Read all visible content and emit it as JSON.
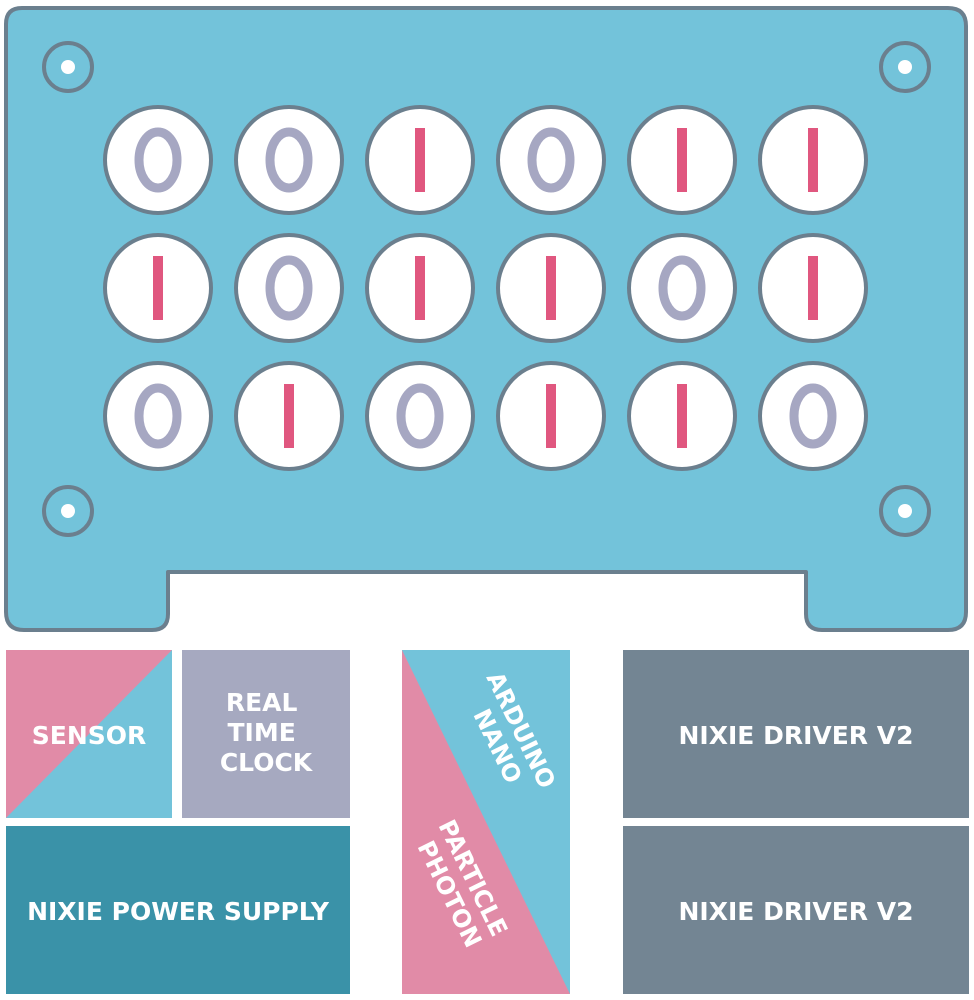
{
  "colors": {
    "panel_fill": "#73c3da",
    "panel_stroke": "#6b7f8e",
    "tube_fill": "#ffffff",
    "digit_zero": "#a6a7c2",
    "digit_one": "#e0577f",
    "sensor_pink": "#e18ba7",
    "sensor_teal": "#73c3da",
    "rtc": "#a6a9c0",
    "power_supply": "#3a92a8",
    "driver": "#738593",
    "mcu_teal": "#73c3da",
    "mcu_pink": "#e18ba7",
    "label_text": "#ffffff"
  },
  "tubes": {
    "rows": [
      [
        "0",
        "0",
        "1",
        "0",
        "1",
        "1"
      ],
      [
        "1",
        "0",
        "1",
        "1",
        "0",
        "1"
      ],
      [
        "0",
        "1",
        "0",
        "1",
        "1",
        "0"
      ]
    ]
  },
  "modules": {
    "sensor": "SENSOR",
    "rtc": [
      "REAL",
      "TIME",
      "CLOCK"
    ],
    "power_supply": "NIXIE POWER SUPPLY",
    "arduino": [
      "ARDUINO",
      "NANO"
    ],
    "photon": [
      "PARTICLE",
      "PHOTON"
    ],
    "driver_top": "NIXIE DRIVER V2",
    "driver_bottom": "NIXIE DRIVER V2"
  }
}
